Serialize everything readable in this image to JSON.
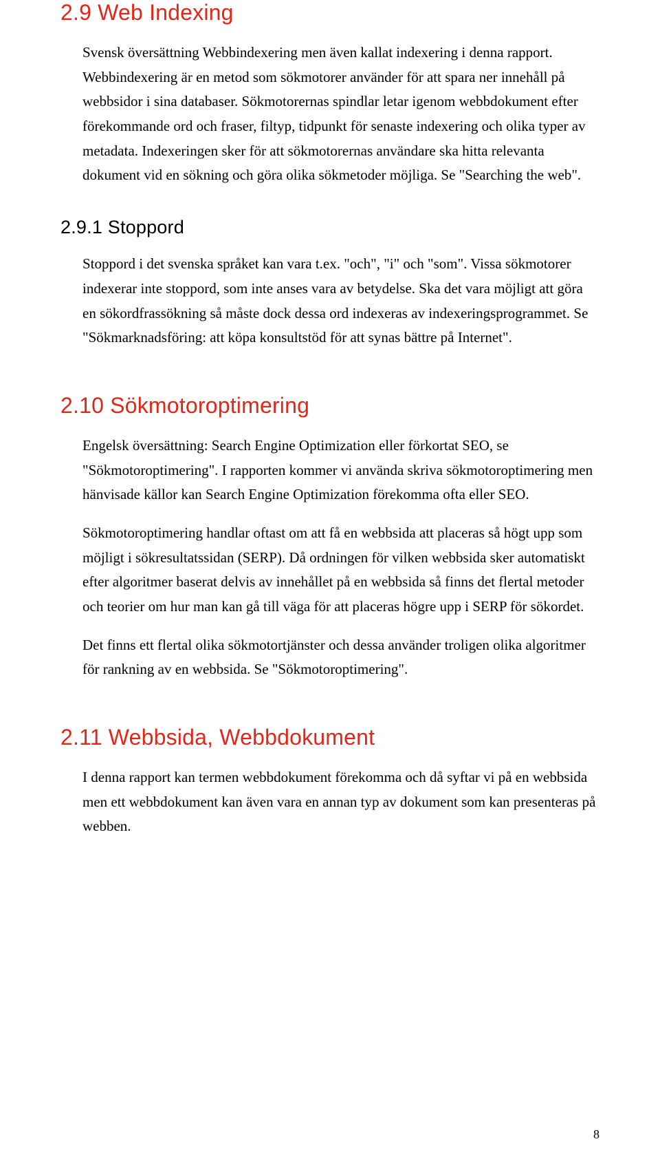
{
  "sections": [
    {
      "heading": "2.9  Web Indexing",
      "paragraphs": [
        "Svensk översättning Webbindexering men även kallat indexering i denna rapport. Webbindexering är en metod som sökmotorer använder för att spara ner innehåll på webbsidor i sina databaser. Sökmotorernas spindlar letar igenom webbdokument efter förekommande ord och fraser, filtyp, tidpunkt för senaste indexering och olika typer av metadata. Indexeringen sker för att sökmotorernas användare ska hitta relevanta dokument vid en sökning och göra olika sökmetoder möjliga. Se \"Searching the web\"."
      ],
      "subsections": [
        {
          "heading": "2.9.1   Stoppord",
          "paragraphs": [
            "Stoppord i det svenska språket kan vara t.ex. \"och\", \"i\" och \"som\". Vissa sökmotorer indexerar inte stoppord, som inte anses vara av betydelse. Ska det vara möjligt att göra en sökordfrassökning så måste dock dessa ord indexeras av indexeringsprogrammet. Se \"Sökmarknadsföring: att köpa konsultstöd för att synas bättre på Internet\"."
          ]
        }
      ]
    },
    {
      "heading": "2.10 Sökmotoroptimering",
      "paragraphs": [
        "Engelsk översättning: Search Engine Optimization eller förkortat SEO, se \"Sökmotoroptimering\". I rapporten kommer vi använda skriva sökmotoroptimering men hänvisade källor kan Search Engine Optimization förekomma ofta eller SEO.",
        "Sökmotoroptimering handlar oftast om att få en webbsida att placeras så högt upp som möjligt i sökresultatssidan (SERP). Då ordningen för vilken webbsida sker automatiskt efter algoritmer baserat delvis av innehållet på en webbsida så finns det flertal metoder och teorier om hur man kan gå till väga för att placeras högre upp i SERP för sökordet.",
        "Det finns ett flertal olika sökmotortjänster och dessa använder troligen olika algoritmer för rankning av en webbsida. Se \"Sökmotoroptimering\"."
      ],
      "subsections": []
    },
    {
      "heading": "2.11 Webbsida, Webbdokument",
      "paragraphs": [
        "I denna rapport kan termen webbdokument förekomma och då syftar vi på en webbsida men ett webbdokument kan även vara en annan typ av dokument som kan presenteras på webben."
      ],
      "subsections": []
    }
  ],
  "pageNumber": "8"
}
